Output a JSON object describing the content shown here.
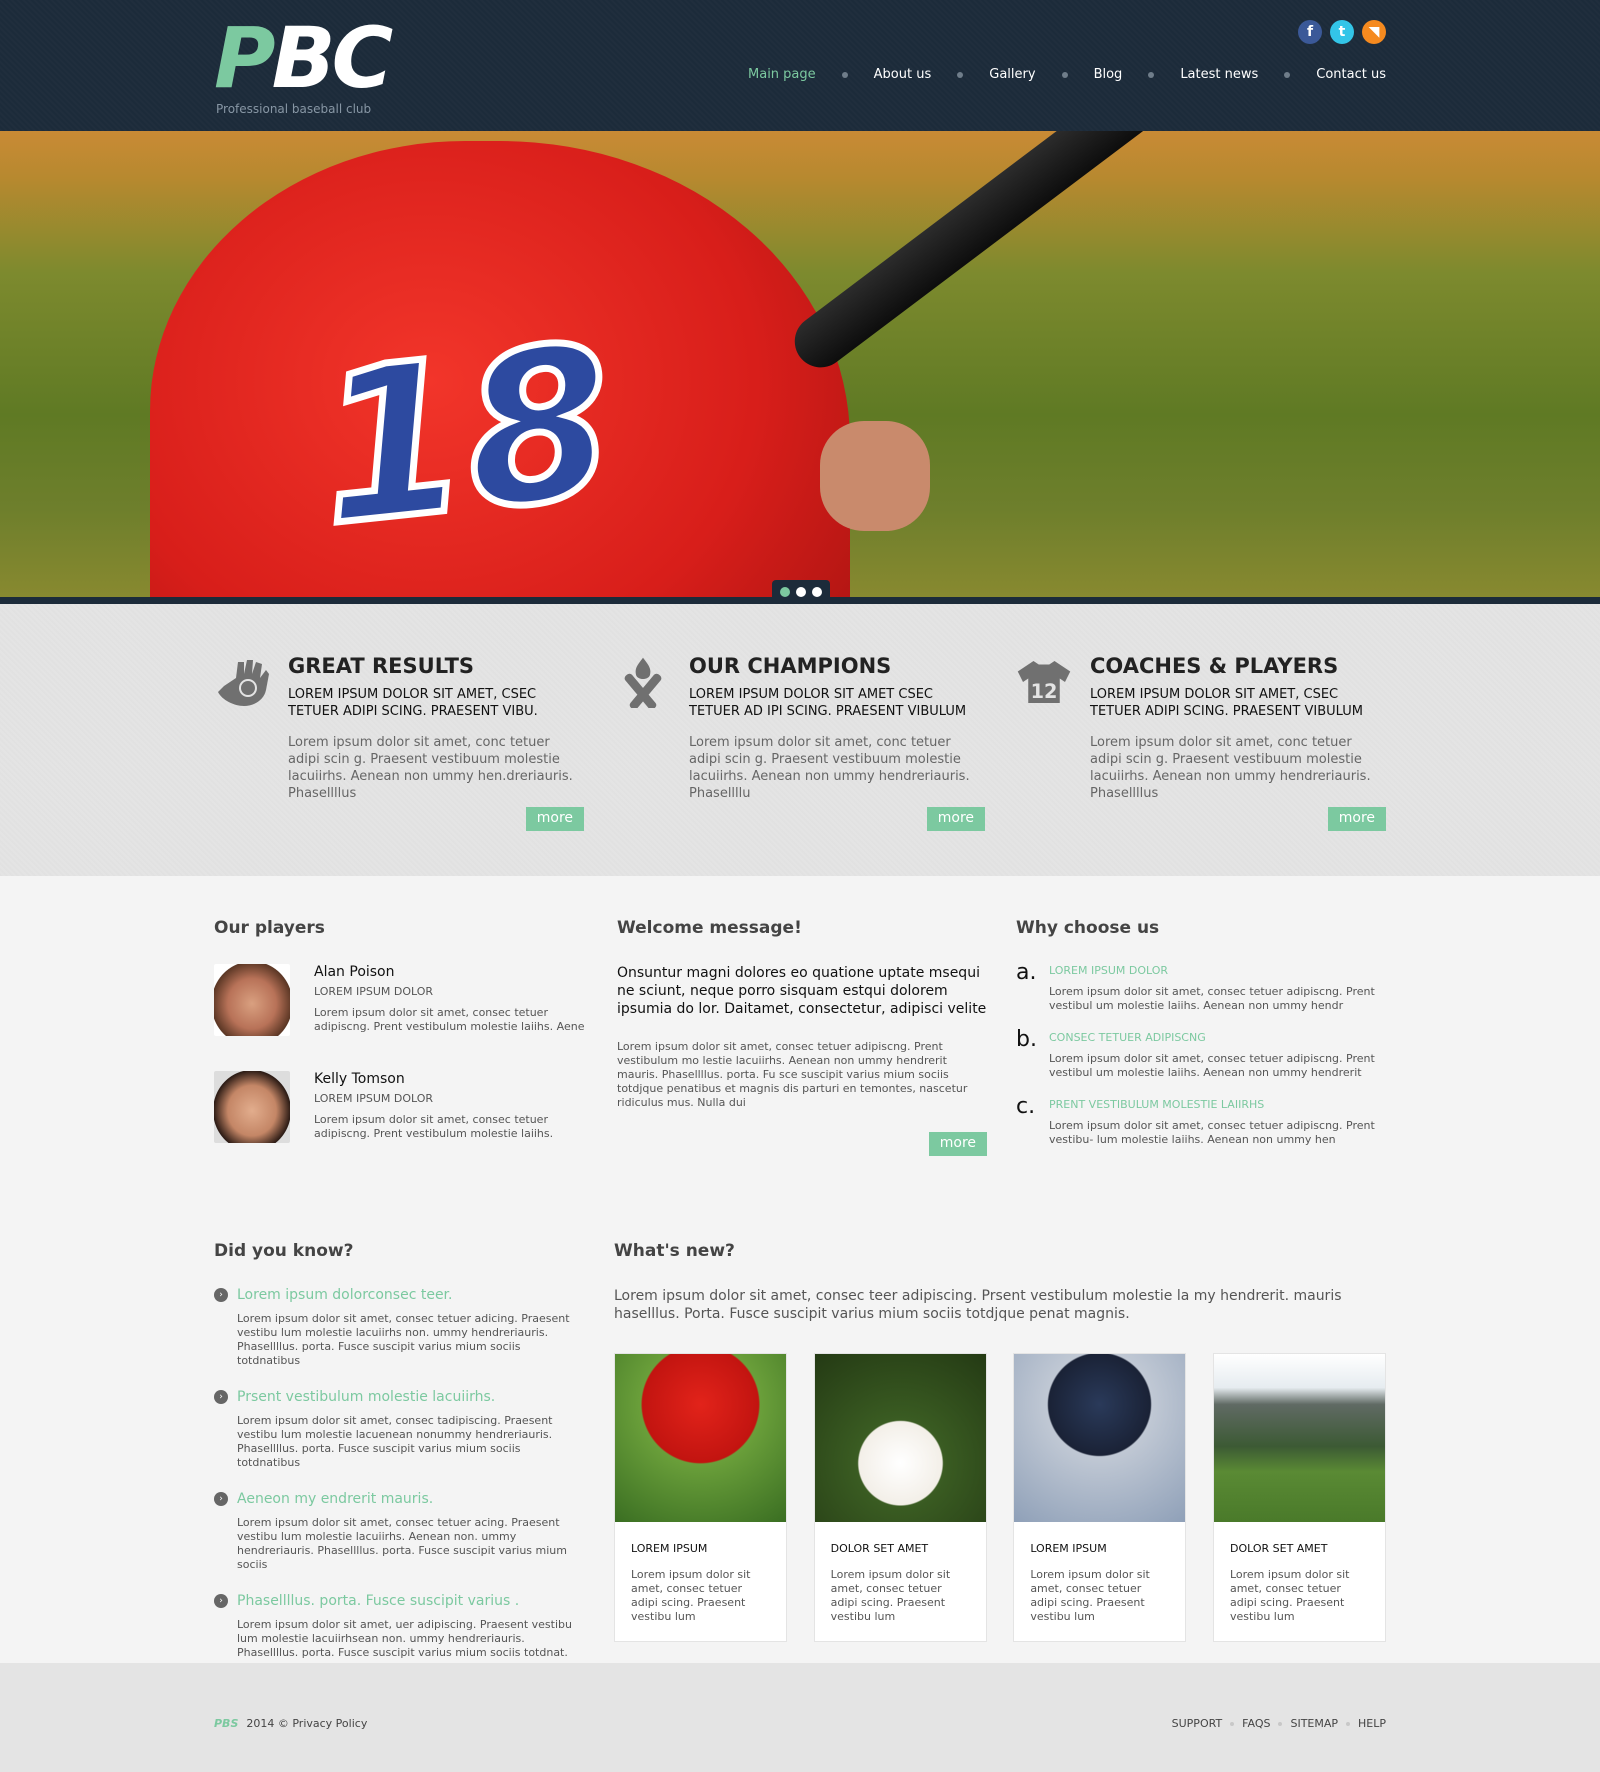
{
  "header": {
    "logo_p": "P",
    "logo_bc": "BC",
    "tagline": "Professional baseball club",
    "social": [
      "facebook-icon",
      "twitter-icon",
      "rss-icon"
    ],
    "nav": [
      {
        "label": "Main page",
        "active": true
      },
      {
        "label": "About us",
        "active": false
      },
      {
        "label": "Gallery",
        "active": false
      },
      {
        "label": "Blog",
        "active": false
      },
      {
        "label": "Latest news",
        "active": false
      },
      {
        "label": "Contact us",
        "active": false
      }
    ]
  },
  "hero": {
    "jersey_number": "18",
    "slides": 3,
    "active_slide": 1
  },
  "features": [
    {
      "icon": "baseball-glove-icon",
      "title": "GREAT RESULTS",
      "subtitle": "LOREM IPSUM DOLOR SIT AMET, CSEC TETUER ADIPI SCING. PRAESENT VIBU.",
      "text": "Lorem ipsum dolor sit amet, conc tetuer adipi scin g. Praesent vestibuum molestie lacuiirhs. Aenean non ummy hen.dreriauris. Phasellllus",
      "button": "more"
    },
    {
      "icon": "crossed-bats-icon",
      "title": "OUR CHAMPIONS",
      "subtitle": "LOREM IPSUM DOLOR SIT AMET CSEC TETUER AD IPI SCING. PRAESENT VIBULUM",
      "text": "Lorem ipsum dolor sit amet, conc tetuer adipi scin g. Praesent vestibuum molestie lacuiirhs. Aenean non ummy hendreriauris. Phasellllu",
      "button": "more"
    },
    {
      "icon": "jersey-icon",
      "title": "COACHES & PLAYERS",
      "subtitle": "LOREM IPSUM DOLOR SIT AMET, CSEC TETUER ADIPI SCING. PRAESENT VIBULUM",
      "text": "Lorem ipsum dolor sit amet, conc tetuer adipi scin g. Praesent vestibuum molestie lacuiirhs. Aenean non ummy hendreriauris. Phasellllus",
      "button": "more"
    }
  ],
  "players": {
    "title": "Our players",
    "items": [
      {
        "name": "Alan Poison",
        "role": "LOREM IPSUM DOLOR",
        "text": "Lorem ipsum dolor sit amet, consec tetuer adipiscng. Prent vestibulum molestie laiihs. Aene"
      },
      {
        "name": "Kelly Tomson",
        "role": "LOREM IPSUM DOLOR",
        "text": "Lorem ipsum dolor sit amet, consec tetuer adipiscng. Prent vestibulum molestie laiihs."
      }
    ]
  },
  "welcome": {
    "title": "Welcome message!",
    "lead": "Onsuntur magni dolores eo quatione uptate msequi ne sciunt, neque porro sisquam estqui dolorem ipsumia do lor. Daitamet, consectetur, adipisci velite",
    "text": "Lorem ipsum dolor sit amet, consec tetuer adipiscng. Prent vestibulum mo lestie lacuiirhs. Aenean non ummy hendrerit mauris. Phasellllus. porta. Fu sce suscipit varius mium sociis totdjque penatibus et magnis dis parturi en temontes, nascetur ridiculus mus. Nulla dui",
    "button": "more"
  },
  "why": {
    "title": "Why choose us",
    "items": [
      {
        "letter": "a.",
        "title": "LOREM IPSUM DOLOR",
        "text": "Lorem ipsum dolor sit amet, consec tetuer adipiscng. Prent vestibul um molestie laiihs. Aenean non ummy hendr"
      },
      {
        "letter": "b.",
        "title": "CONSEC TETUER ADIPISCNG",
        "text": "Lorem ipsum dolor sit amet, consec tetuer adipiscng. Prent vestibul um molestie laiihs. Aenean non ummy hendrerit"
      },
      {
        "letter": "c.",
        "title": "PRENT VESTIBULUM MOLESTIE LAIIRHS",
        "text": "Lorem ipsum dolor sit amet, consec tetuer adipiscng. Prent vestibu- lum molestie laiihs. Aenean non ummy hen"
      }
    ]
  },
  "did_you_know": {
    "title": "Did you know?",
    "items": [
      {
        "title": "Lorem ipsum dolorconsec teer.",
        "text": "Lorem ipsum dolor sit amet, consec tetuer adicing. Praesent vestibu lum molestie lacuiirhs non. ummy hendreriauris. Phasellllus. porta. Fusce suscipit varius mium sociis totdnatibus"
      },
      {
        "title": "Prsent vestibulum molestie lacuiirhs.",
        "text": "Lorem ipsum dolor sit amet, consec tadipiscing. Praesent vestibu lum molestie lacuenean nonummy hendreriauris. Phasellllus. porta. Fusce suscipit varius mium sociis totdnatibus"
      },
      {
        "title": "Aeneon my  endrerit mauris.",
        "text": "Lorem ipsum dolor sit amet, consec tetuer acing. Praesent vestibu lum molestie lacuiirhs. Aenean non. ummy hendreriauris. Phasellllus. porta. Fusce suscipit varius mium sociis"
      },
      {
        "title": "Phasellllus. porta. Fusce suscipit varius .",
        "text": "Lorem ipsum dolor sit amet, uer adipiscing. Praesent vestibu lum molestie lacuiirhsean non.  ummy hendreriauris. Phasellllus. porta. Fusce suscipit varius mium sociis totdnat."
      }
    ]
  },
  "whats_new": {
    "title": "What's new?",
    "lead": "Lorem ipsum dolor sit amet, consec teer adipiscing. Prsent vestibulum molestie la my hendrerit. mauris haselllus.  Porta. Fusce suscipit varius mium sociis totdjque penat magnis.",
    "cards": [
      {
        "image": "child-in-helmet-photo",
        "title": "LOREM IPSUM",
        "text": "Lorem ipsum dolor sit amet, consec tetuer adipi scing. Praesent vestibu lum"
      },
      {
        "image": "baseball-and-glove-photo",
        "title": "DOLOR SET AMET",
        "text": "Lorem ipsum dolor sit amet, consec tetuer adipi scing. Praesent vestibu lum"
      },
      {
        "image": "batter-photo",
        "title": "LOREM IPSUM",
        "text": "Lorem ipsum dolor sit amet, consec tetuer adipi scing. Praesent vestibu lum"
      },
      {
        "image": "stadium-photo",
        "title": "DOLOR SET AMET",
        "text": "Lorem ipsum dolor sit amet, consec tetuer adipi scing. Praesent vestibu lum"
      }
    ]
  },
  "footer": {
    "brand": "PBS",
    "copyright": "2014 © Privacy Policy",
    "links": [
      "SUPPORT",
      "FAQS",
      "SITEMAP",
      "HELP"
    ]
  },
  "colors": {
    "accent": "#7cc9a0",
    "header_bg": "#1c2b3a",
    "features_bg": "#e4e4e4",
    "page_bg": "#f4f4f4"
  }
}
